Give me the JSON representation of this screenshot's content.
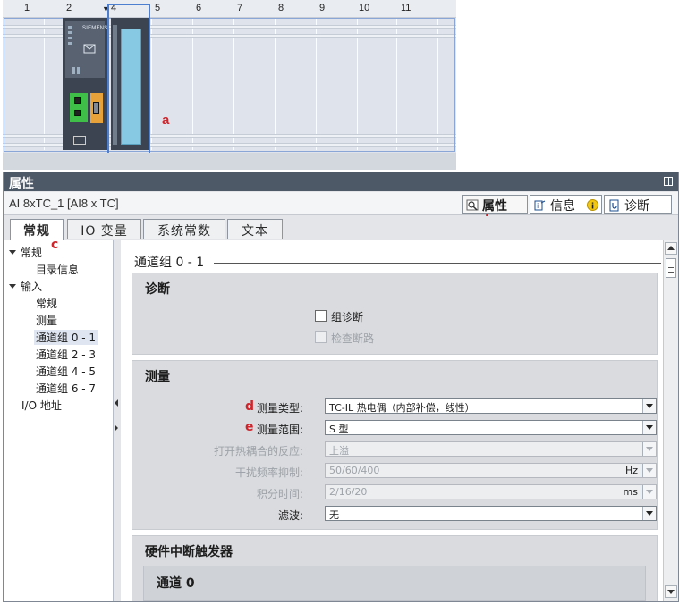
{
  "rack": {
    "slots": [
      "1",
      "2",
      "4",
      "5",
      "6",
      "7",
      "8",
      "9",
      "10",
      "11"
    ],
    "cpu_brand": "SIEMENS",
    "annotation": "a"
  },
  "window": {
    "title": "属性",
    "object_name": "AI 8xTC_1 [AI8 x TC]",
    "right_tabs": [
      {
        "label": "属性",
        "icon": "properties-icon",
        "active": true
      },
      {
        "label": "信息",
        "icon": "info-icon"
      },
      {
        "label": "诊断",
        "icon": "diagnostics-icon"
      }
    ],
    "annotation_b": "b"
  },
  "tabs": [
    "常规",
    "IO 变量",
    "系统常数",
    "文本"
  ],
  "nav": {
    "annotation_c": "c",
    "items": [
      {
        "label": "常规"
      },
      {
        "label": "目录信息"
      },
      {
        "label": "输入"
      },
      {
        "label": "常规"
      },
      {
        "label": "测量"
      },
      {
        "label": "通道组 0 - 1"
      },
      {
        "label": "通道组 2 - 3"
      },
      {
        "label": "通道组 4 - 5"
      },
      {
        "label": "通道组 6 - 7"
      },
      {
        "label": "I/O 地址"
      }
    ]
  },
  "content": {
    "section_title": "通道组 0 - 1",
    "diag": {
      "title": "诊断",
      "group_diag": "组诊断",
      "check_wire": "检查断路"
    },
    "measure": {
      "title": "测量",
      "annotation_d": "d",
      "annotation_e": "e",
      "type_label": "测量类型:",
      "type_value": "TC-IL 热电偶（内部补偿，线性）",
      "range_label": "测量范围:",
      "range_value": "S 型",
      "open_tc_label": "打开热耦合的反应:",
      "open_tc_value": "上溢",
      "interference_label": "干扰频率抑制:",
      "interference_value": "50/60/400",
      "interference_unit": "Hz",
      "integration_label": "积分时间:",
      "integration_value": "2/16/20",
      "integration_unit": "ms",
      "filter_label": "滤波:",
      "filter_value": "无"
    },
    "hw_interrupt": {
      "title": "硬件中断触发器",
      "channel": "通道 0"
    }
  }
}
